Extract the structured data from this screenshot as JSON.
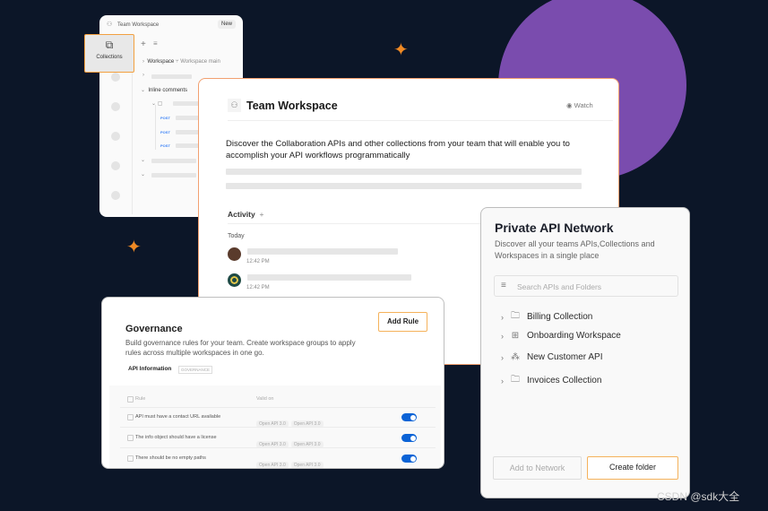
{
  "colors": {
    "background": "#0c1628",
    "accent": "#f08a24",
    "circle": "#7a4cae",
    "toggle": "#0b63d6"
  },
  "sidebar_card": {
    "title": "Team Workspace",
    "new_label": "New",
    "collections_label": "Collections",
    "workspace_label": "Workspace",
    "branch_label": "Workspace main",
    "inline_comments": "Inline comments",
    "method": "POST"
  },
  "workspace_card": {
    "title": "Team Workspace",
    "watch_label": "Watch",
    "description": "Discover the Collaboration APIs and other collections from your team that will enable you to accomplish your API workflows programmatically",
    "activity_label": "Activity",
    "today_label": "Today",
    "activities": [
      {
        "time": "12:42 PM"
      },
      {
        "time": "12:42 PM"
      }
    ]
  },
  "governance_card": {
    "title": "Governance",
    "description": "Build governance rules for your team. Create workspace groups to apply rules across multiple workspaces in one go.",
    "add_rule_label": "Add Rule",
    "api_info_label": "API Information",
    "badge": "GOVERNANCE",
    "columns": [
      "Rule",
      "Valid on"
    ],
    "rules": [
      {
        "rule": "API must have a contact URL available",
        "chips": [
          "Open API 3.0",
          "Open API 3.0"
        ],
        "enabled": true
      },
      {
        "rule": "The info object should have a license",
        "chips": [
          "Open API 3.0",
          "Open API 3.0"
        ],
        "enabled": true
      },
      {
        "rule": "There should be no empty paths",
        "chips": [
          "Open API 3.0",
          "Open API 3.0"
        ],
        "enabled": true
      }
    ]
  },
  "network_card": {
    "title": "Private API Network",
    "description": "Discover all your teams APIs,Collections and Workspaces in a single place",
    "search_placeholder": "Search APIs and Folders",
    "items": [
      {
        "label": "Billing Collection",
        "icon": "folder-icon"
      },
      {
        "label": "Onboarding Workspace",
        "icon": "grid-icon"
      },
      {
        "label": "New Customer API",
        "icon": "api-icon"
      },
      {
        "label": "Invoices Collection",
        "icon": "folder-icon"
      }
    ],
    "add_to_network_label": "Add to Network",
    "create_folder_label": "Create folder"
  },
  "watermark": "CSDN @sdk大全"
}
